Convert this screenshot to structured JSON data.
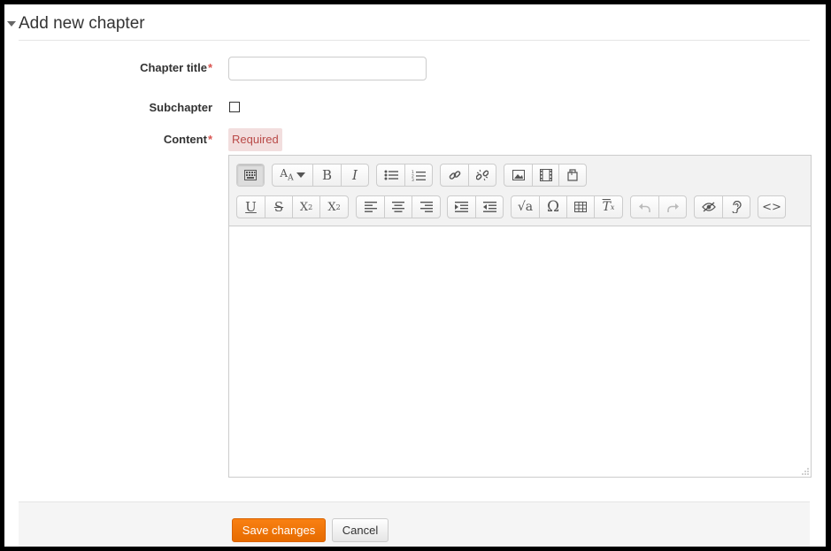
{
  "section": {
    "title": "Add new chapter",
    "collapse_icon": "caret-down-icon"
  },
  "form": {
    "chapter_title": {
      "label": "Chapter title",
      "required_mark": "*",
      "value": "",
      "placeholder": ""
    },
    "subchapter": {
      "label": "Subchapter",
      "checked": false
    },
    "content": {
      "label": "Content",
      "required_mark": "*",
      "required_badge": "Required"
    }
  },
  "editor": {
    "toolbar_row1": [
      [
        "toolbar-toggle-icon"
      ],
      [
        "font-style-icon"
      ],
      [
        "bold-icon",
        "italic-icon"
      ],
      [
        "bullet-list-icon",
        "numbered-list-icon"
      ],
      [
        "link-icon",
        "unlink-icon"
      ],
      [
        "image-icon",
        "media-icon",
        "manage-files-icon"
      ]
    ],
    "toolbar_row2": [
      [
        "underline-icon",
        "strikethrough-icon",
        "subscript-icon",
        "superscript-icon"
      ],
      [
        "align-left-icon",
        "align-center-icon",
        "align-right-icon"
      ],
      [
        "indent-icon",
        "outdent-icon"
      ],
      [
        "equation-icon",
        "special-character-icon",
        "table-icon",
        "clear-formatting-icon"
      ],
      [
        "undo-icon",
        "redo-icon"
      ],
      [
        "accessibility-checker-icon",
        "screen-reader-helper-icon"
      ],
      [
        "html-icon"
      ]
    ],
    "body_text": ""
  },
  "actions": {
    "save_label": "Save changes",
    "cancel_label": "Cancel"
  },
  "colors": {
    "primary": "#f98012",
    "required": "#d9534f",
    "badge_bg": "#f2dede"
  }
}
